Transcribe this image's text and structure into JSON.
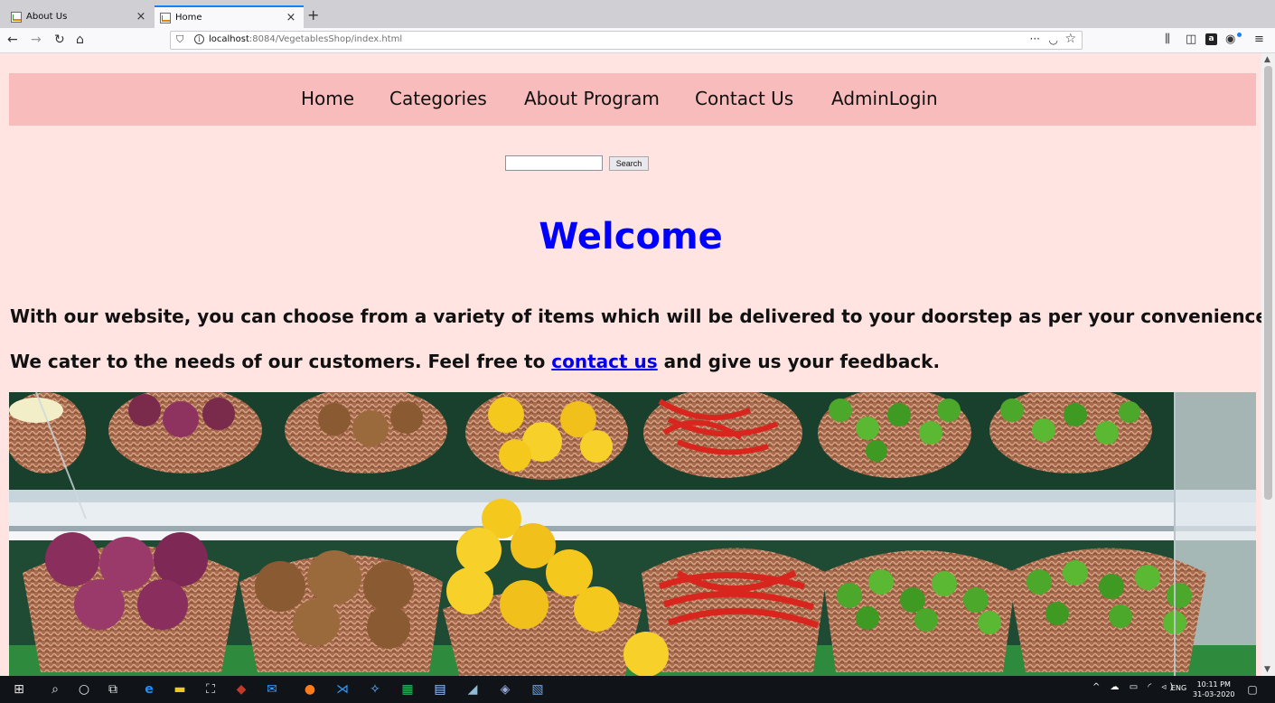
{
  "browser": {
    "tabs": [
      {
        "label": "About Us",
        "active": false
      },
      {
        "label": "Home",
        "active": true
      }
    ],
    "new_tab": "+",
    "close_glyph": "×",
    "url_host": "localhost",
    "url_path": ":8084/VegetablesShop/index.html",
    "page_actions_glyph": "···",
    "accent_color": "#0a84ff"
  },
  "nav": {
    "items": [
      "Home",
      "Categories",
      "About Program",
      "Contact Us",
      "AdminLogin"
    ],
    "bar_color": "#f8bcbc"
  },
  "search": {
    "value": "",
    "button_label": "Search"
  },
  "page": {
    "heading": "Welcome",
    "heading_color": "#0000ff",
    "background_color": "#ffe4e1",
    "para1": "With our website, you can choose from a variety of items which will be delivered to your doorstep as per your convenience.",
    "para2_before": "We cater to the needs of our customers. Feel free to ",
    "para2_link": "contact us",
    "para2_after": " and give us your feedback."
  },
  "taskbar": {
    "lang": "ENG",
    "time": "10:11 PM",
    "date": "31-03-2020"
  }
}
